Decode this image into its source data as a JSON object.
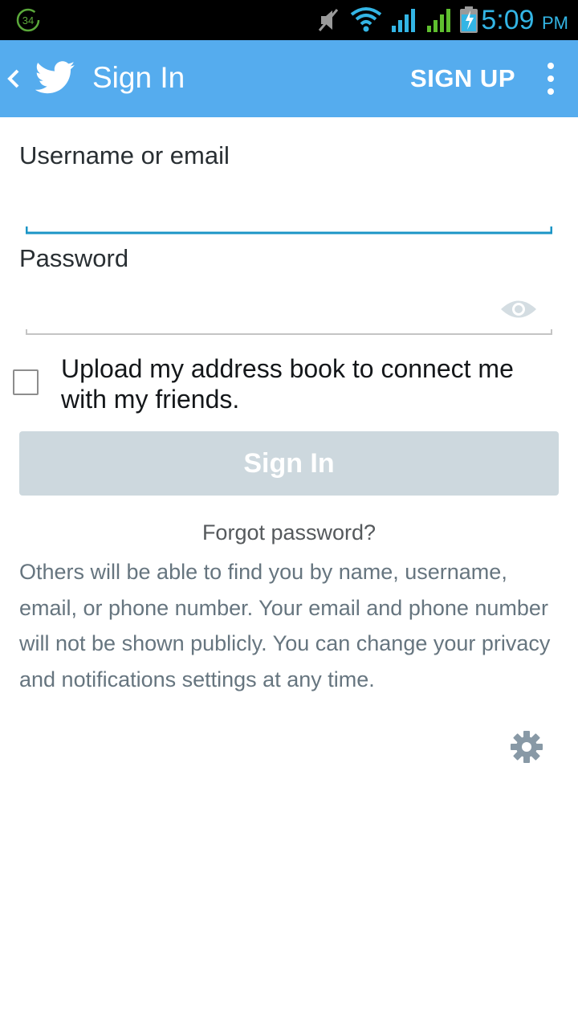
{
  "status_bar": {
    "notification_badge": "34",
    "time": "5:09",
    "ampm": "PM",
    "icons": [
      "muted-speaker-icon",
      "wifi-icon",
      "signal-sim1-icon",
      "signal-sim2-icon",
      "battery-charging-icon"
    ]
  },
  "app_bar": {
    "title": "Sign In",
    "signup_label": "SIGN UP",
    "background": "#55acee"
  },
  "form": {
    "username_label": "Username or email",
    "username_value": "",
    "password_label": "Password",
    "password_value": "",
    "address_book_label": "Upload my address book to connect me with my friends.",
    "address_book_checked": false,
    "signin_label": "Sign In",
    "forgot_label": "Forgot password?"
  },
  "privacy_text": "Others will be able to find you by name, username, email, or phone number. Your email and phone number will not be shown publicly. You can change your privacy and notifications settings at any time.",
  "colors": {
    "accent": "#55acee",
    "focus_underline": "#1b95c6",
    "disabled_button": "#cdd8de"
  }
}
